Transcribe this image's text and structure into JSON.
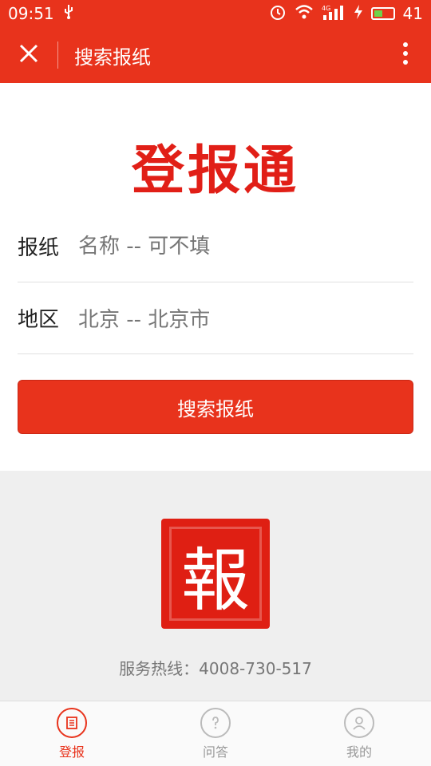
{
  "status_bar": {
    "time": "09:51",
    "signal_label": "4G",
    "battery": "41"
  },
  "app_bar": {
    "title": "搜索报纸"
  },
  "brand": {
    "title": "登报通"
  },
  "form": {
    "paper_label": "报纸",
    "paper_placeholder": "名称 -- 可不填",
    "region_label": "地区",
    "region_value": "北京 -- 北京市",
    "search_button": "搜索报纸"
  },
  "footer": {
    "seal_char": "報",
    "hotline": "服务热线：4008-730-517"
  },
  "bottom_nav": {
    "items": [
      {
        "label": "登报"
      },
      {
        "label": "问答"
      },
      {
        "label": "我的"
      }
    ]
  },
  "colors": {
    "primary": "#e8331c",
    "brand_red": "#e11f17"
  }
}
